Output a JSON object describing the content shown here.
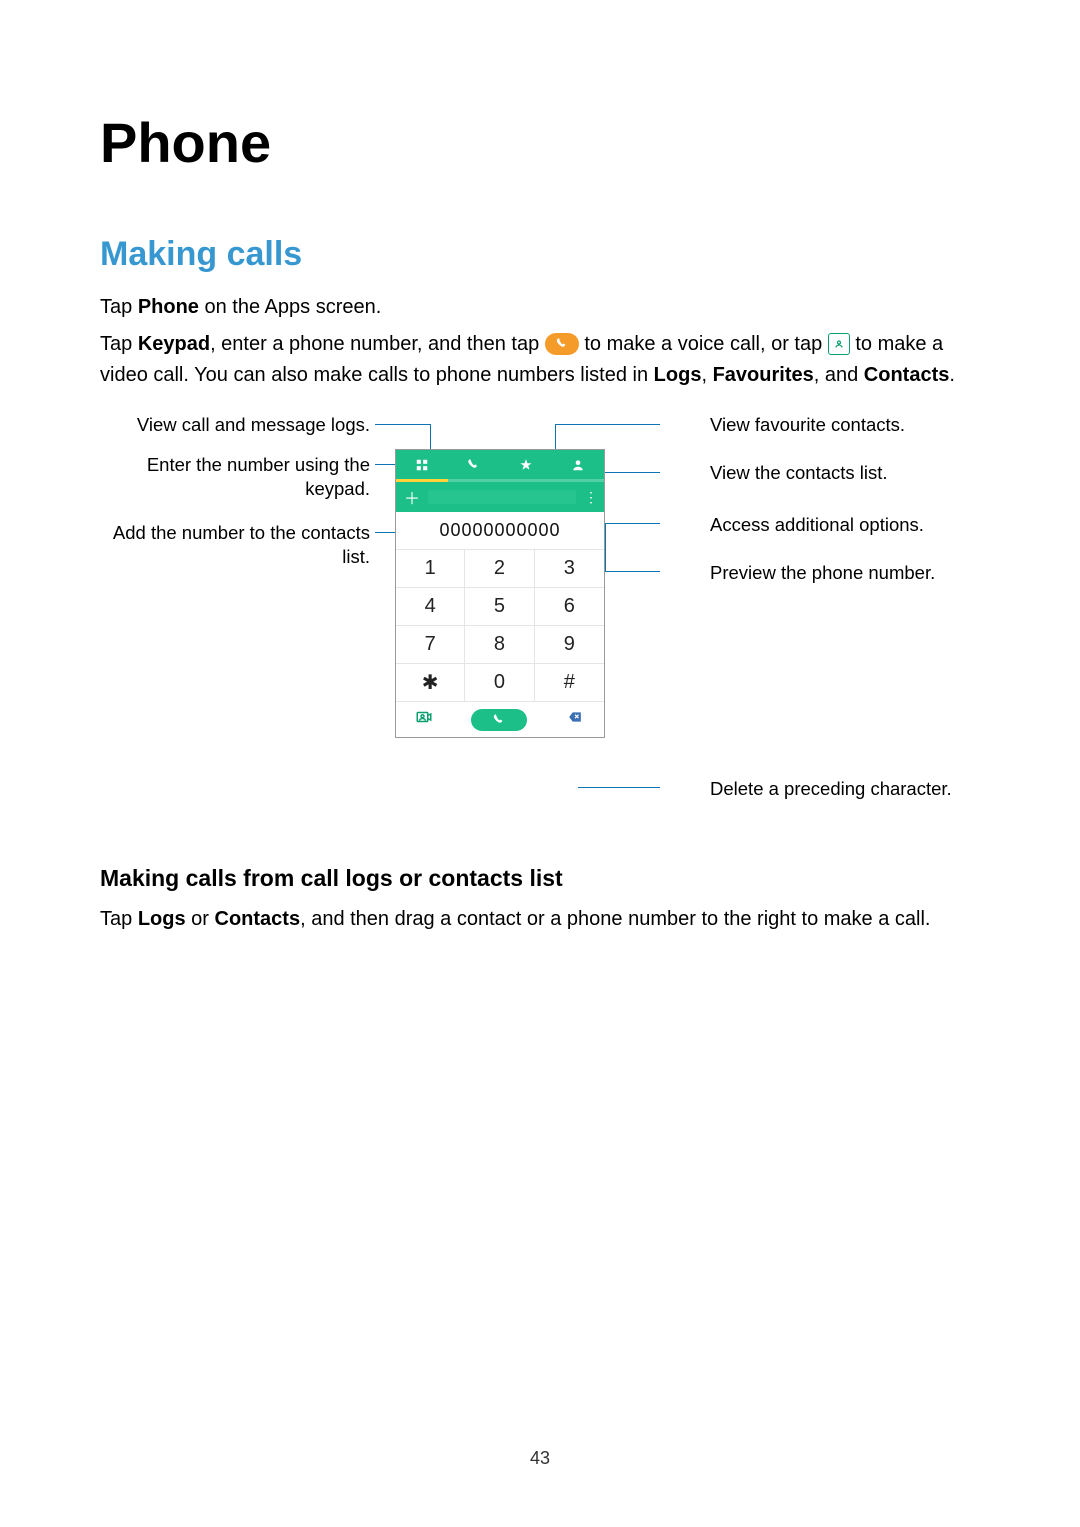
{
  "h1": "Phone",
  "h2": "Making calls",
  "p1": {
    "pre": "Tap ",
    "b1": "Phone",
    "post": " on the Apps screen."
  },
  "p2": {
    "s1": "Tap ",
    "b1": "Keypad",
    "s2": ", enter a phone number, and then tap ",
    "s3": " to make a voice call, or tap ",
    "s4": " to make a video call. You can also make calls to phone numbers listed in ",
    "b2": "Logs",
    "s5": ", ",
    "b3": "Favourites",
    "s6": ", and ",
    "b4": "Contacts",
    "s7": "."
  },
  "callouts": {
    "left": [
      "View call and message logs.",
      "Enter the number using the keypad.",
      "Add the number to the contacts list."
    ],
    "right": [
      "View favourite contacts.",
      "View the contacts list.",
      "Access additional options.",
      "Preview the phone number.",
      "Delete a preceding character."
    ]
  },
  "phone": {
    "number": "00000000000",
    "keys": [
      "1",
      "2",
      "3",
      "4",
      "5",
      "6",
      "7",
      "8",
      "9",
      "✱",
      "0",
      "#"
    ]
  },
  "h3": "Making calls from call logs or contacts list",
  "p3": {
    "s1": "Tap ",
    "b1": "Logs",
    "s2": " or ",
    "b2": "Contacts",
    "s3": ", and then drag a contact or a phone number to the right to make a call."
  },
  "pagenum": "43"
}
